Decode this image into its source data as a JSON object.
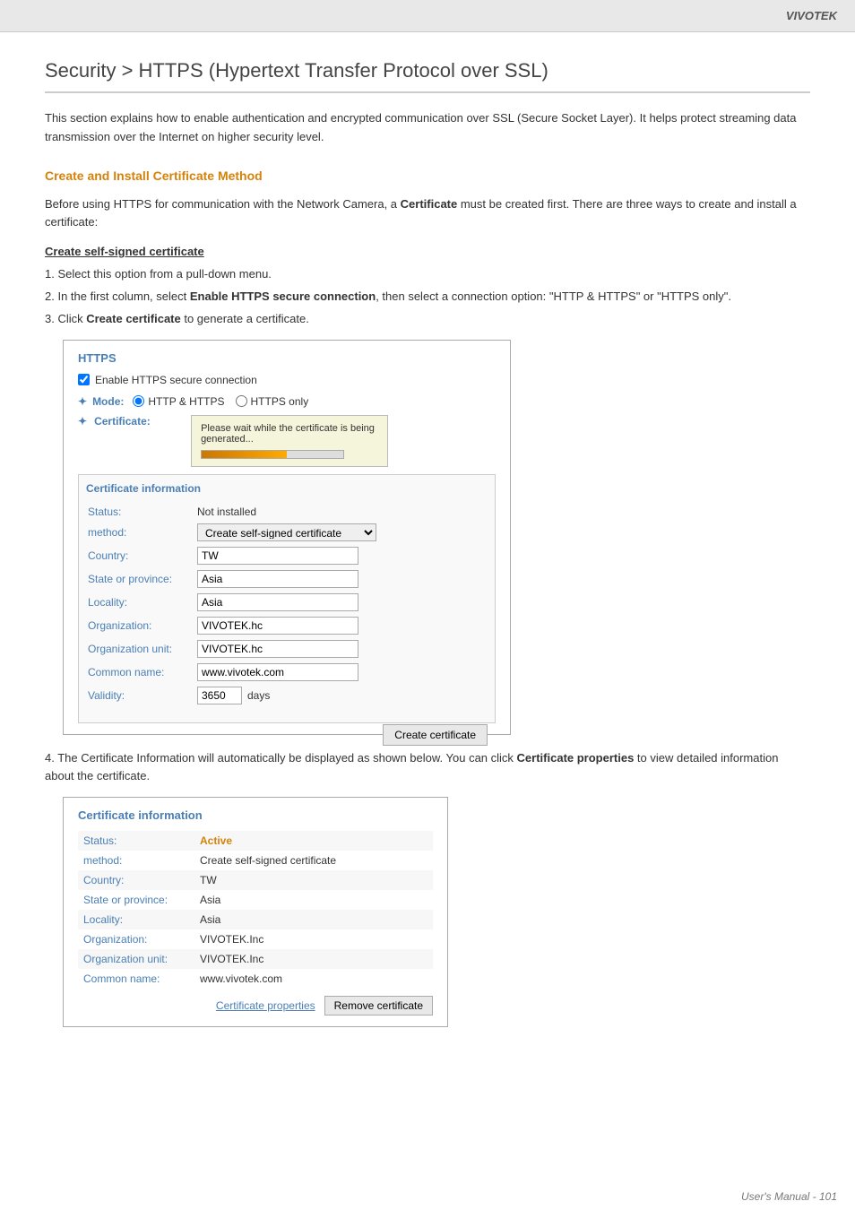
{
  "brand": "VIVOTEK",
  "page_title": "Security >  HTTPS (Hypertext Transfer Protocol over SSL)",
  "intro_text": "This section explains how to enable authentication and encrypted communication over SSL (Secure Socket Layer). It helps protect streaming data transmission over the Internet on higher security level.",
  "section_heading": "Create and Install Certificate Method",
  "body_text": "Before using HTTPS for communication with the Network Camera, a Certificate must be created first. There are three ways to create and install a certificate:",
  "subsection_heading": "Create self-signed certificate",
  "steps": [
    "1. Select this option from a pull-down menu.",
    "2. In the first column, select Enable HTTPS secure connection, then select a connection option: \"HTTP & HTTPS\" or \"HTTPS only\".",
    "3. Click Create certificate to generate a certificate."
  ],
  "https_box": {
    "title": "HTTPS",
    "enable_label": "Enable HTTPS secure connection",
    "mode_label": "Mode:",
    "http_https_label": "HTTP & HTTPS",
    "https_only_label": "HTTPS only",
    "cert_label": "Certificate:",
    "popup_text": "Please wait while the certificate is being generated...",
    "cert_info_title": "Certificate information",
    "fields": [
      {
        "label": "Status:",
        "value": "Not installed",
        "type": "text"
      },
      {
        "label": "method:",
        "value": "Create self-signed certificate",
        "type": "dropdown"
      },
      {
        "label": "Country:",
        "value": "TW",
        "type": "input"
      },
      {
        "label": "State or province:",
        "value": "Asia",
        "type": "input"
      },
      {
        "label": "Locality:",
        "value": "Asia",
        "type": "input"
      },
      {
        "label": "Organization:",
        "value": "VIVOTEK.hc",
        "type": "input"
      },
      {
        "label": "Organization unit:",
        "value": "VIVOTEK.hc",
        "type": "input"
      },
      {
        "label": "Common name:",
        "value": "www.vivotek.com",
        "type": "input"
      },
      {
        "label": "Validity:",
        "value": "3650",
        "unit": "days",
        "type": "validity"
      }
    ],
    "create_btn": "Create certificate"
  },
  "step4_text": "4. The Certificate Information will automatically be displayed as shown below. You can click Certificate properties to view detailed information about the certificate.",
  "cert_info_box2": {
    "title": "Certificate information",
    "fields": [
      {
        "label": "Status:",
        "value": "Active",
        "type": "active"
      },
      {
        "label": "method:",
        "value": "Create self-signed certificate"
      },
      {
        "label": "Country:",
        "value": "TW"
      },
      {
        "label": "State or province:",
        "value": "Asia"
      },
      {
        "label": "Locality:",
        "value": "Asia"
      },
      {
        "label": "Organization:",
        "value": "VIVOTEK.Inc"
      },
      {
        "label": "Organization unit:",
        "value": "VIVOTEK.Inc"
      },
      {
        "label": "Common name:",
        "value": "www.vivotek.com"
      }
    ],
    "cert_props_link": "Certificate properties",
    "remove_btn": "Remove certificate"
  },
  "footer_text": "User's Manual - 101"
}
